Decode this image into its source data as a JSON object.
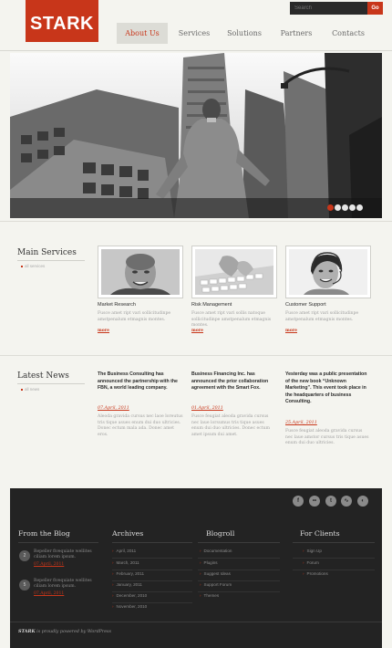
{
  "header": {
    "logo": "STARK",
    "search": {
      "placeholder": "Search",
      "button": "Go"
    },
    "nav": [
      {
        "label": "About Us",
        "active": true
      },
      {
        "label": "Services",
        "active": false
      },
      {
        "label": "Solutions",
        "active": false
      },
      {
        "label": "Partners",
        "active": false
      },
      {
        "label": "Contacts",
        "active": false
      }
    ]
  },
  "slider": {
    "slide_count": 5,
    "active_slide": 1
  },
  "main_services": {
    "title": "Main Services",
    "link": "all services",
    "items": [
      {
        "title": "Market Research",
        "text": "Fusce amet ript vari sollicitudinpe amstpenalum etmagnis montes.",
        "more": "more"
      },
      {
        "title": "Risk Management",
        "text": "Fusce amet ript vari sollis natoque sollicitudinpe amstpenalum etmagnis montes.",
        "more": "more"
      },
      {
        "title": "Customer Support",
        "text": "Fusce amet ript vari sollicitudinpe amstpenalum etmagnis montes.",
        "more": "more"
      }
    ]
  },
  "latest_news": {
    "title": "Latest News",
    "link": "all news",
    "items": [
      {
        "headline": "The Business Consulting has announced the partnership with the FBN, a world leading company.",
        "date": "07.April, 2011",
        "text": "Aleoda gravida cursus nec laoe loreutus tris tique asues enum dui duo ultricies. Donec ectum mala ada. Donec amet eros."
      },
      {
        "headline": "Business Financing Inc. has announced the prior collaboration agreement with the Smart Fox.",
        "date": "01.April, 2011",
        "text": "Fusce feugiat aleoda gravida cursus nec laue lorsumus tris tique asues enum dui duo ultricies. Donec ectum amet ipsum dui amet."
      },
      {
        "headline": "Yesterday was a public presentation of the new book “Unknown Marketing”. This event took place in the headquarters of business Consulting.",
        "date": "25.April, 2011",
        "text": "Fusce feugiat aleoda gravida cursus nec laue amstor cursus tris tique asues enum dui duo ultricies."
      }
    ]
  },
  "footer": {
    "social": [
      {
        "icon": "facebook-icon",
        "glyph": "f"
      },
      {
        "icon": "flickr-icon",
        "glyph": "••"
      },
      {
        "icon": "twitter-icon",
        "glyph": "t"
      },
      {
        "icon": "rss-icon",
        "glyph": "∿"
      },
      {
        "icon": "chat-icon",
        "glyph": "◐"
      }
    ],
    "blog": {
      "title": "From the Blog",
      "posts": [
        {
          "count": "2",
          "text": "Repeller fivequiate wellites ciliam lorem ipsum.",
          "date": "07.April, 2011"
        },
        {
          "count": "5",
          "text": "Repeller fivequiate wellites ciliam lorem ipsum.",
          "date": "07.April, 2011"
        }
      ]
    },
    "archives": {
      "title": "Archives",
      "items": [
        "April, 2011",
        "March, 2011",
        "February, 2011",
        "January, 2011",
        "December, 2010",
        "November, 2010"
      ]
    },
    "blogroll": {
      "title": "Blogroll",
      "items": [
        "Documentation",
        "Plugins",
        "Suggest Ideas",
        "Support Forum",
        "Themes"
      ]
    },
    "for_clients": {
      "title": "For Clients",
      "items": [
        "Sign Up",
        "Forum",
        "Promotions"
      ]
    },
    "copyright": {
      "brand": "STARK",
      "text": " is proudly powered by WordPress"
    }
  }
}
